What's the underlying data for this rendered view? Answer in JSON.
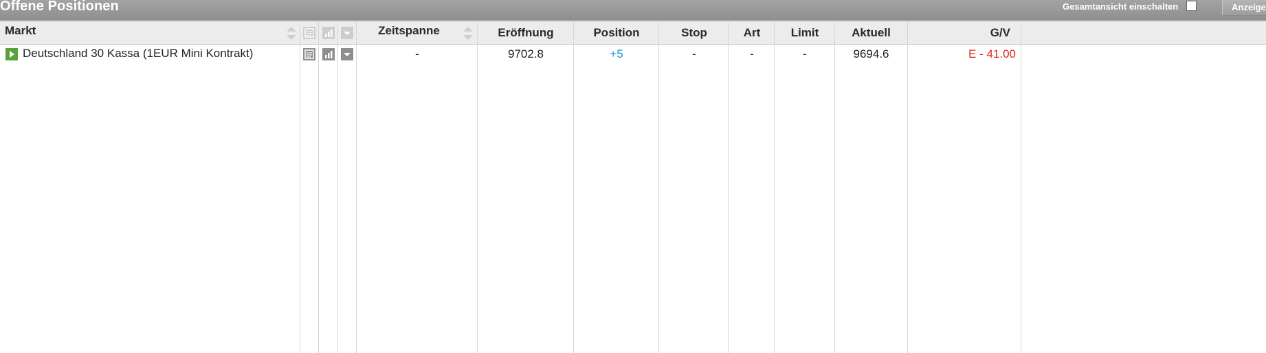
{
  "window": {
    "title": "Offene Positionen",
    "overview_toggle_label": "Gesamtansicht einschalten",
    "overview_checked": false,
    "show_button_label": "Anzeige"
  },
  "table": {
    "columns": {
      "market": "Markt",
      "timespan": "Zeitspanne",
      "opening": "Eröffnung",
      "position": "Position",
      "stop": "Stop",
      "type": "Art",
      "limit": "Limit",
      "current": "Aktuell",
      "pl": "G/V"
    },
    "header_icons": [
      "news-icon",
      "chart-icon",
      "dropdown-icon"
    ],
    "rows": [
      {
        "market": "Deutschland 30 Kassa (1EUR Mini Kontrakt)",
        "timespan": "-",
        "opening": "9702.8",
        "position": "+5",
        "stop": "-",
        "type": "-",
        "limit": "-",
        "current": "9694.6",
        "pl": "E - 41.00"
      }
    ]
  },
  "colors": {
    "titlebar": "#999999",
    "position_value": "#1a8fc9",
    "loss_value": "#e0261f",
    "market_arrow": "#58a23c"
  }
}
